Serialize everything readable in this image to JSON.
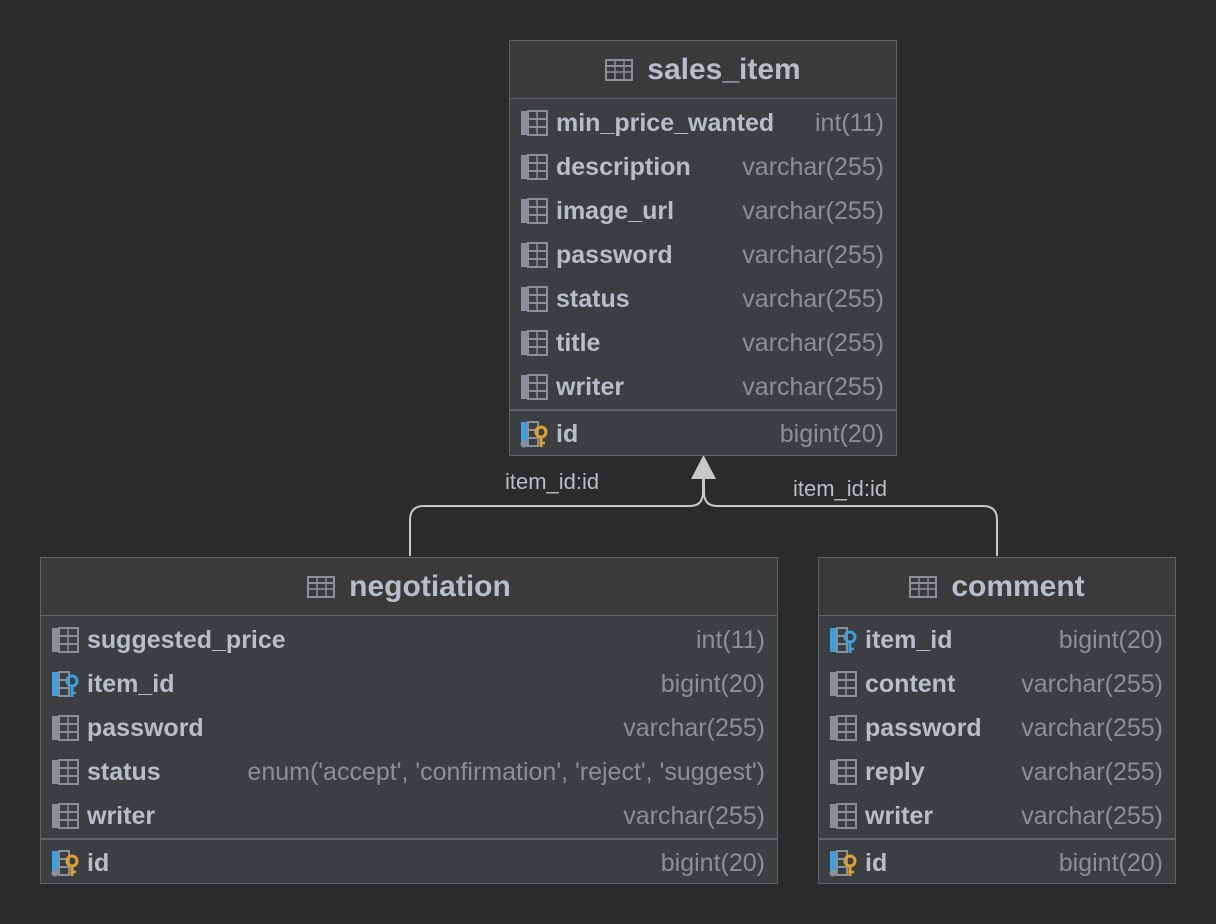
{
  "tables": {
    "sales_item": {
      "name": "sales_item",
      "columns": [
        {
          "name": "min_price_wanted",
          "type": "int(11)",
          "icon": "column-icon"
        },
        {
          "name": "description",
          "type": "varchar(255)",
          "icon": "column-icon"
        },
        {
          "name": "image_url",
          "type": "varchar(255)",
          "icon": "column-icon"
        },
        {
          "name": "password",
          "type": "varchar(255)",
          "icon": "column-icon"
        },
        {
          "name": "status",
          "type": "varchar(255)",
          "icon": "column-icon"
        },
        {
          "name": "title",
          "type": "varchar(255)",
          "icon": "column-icon"
        },
        {
          "name": "writer",
          "type": "varchar(255)",
          "icon": "column-icon"
        }
      ],
      "primary_key": {
        "name": "id",
        "type": "bigint(20)",
        "icon": "primary-key-icon"
      }
    },
    "negotiation": {
      "name": "negotiation",
      "columns": [
        {
          "name": "suggested_price",
          "type": "int(11)",
          "icon": "column-icon"
        },
        {
          "name": "item_id",
          "type": "bigint(20)",
          "icon": "foreign-key-icon"
        },
        {
          "name": "password",
          "type": "varchar(255)",
          "icon": "column-icon"
        },
        {
          "name": "status",
          "type": "enum('accept', 'confirmation', 'reject', 'suggest')",
          "icon": "column-icon"
        },
        {
          "name": "writer",
          "type": "varchar(255)",
          "icon": "column-icon"
        }
      ],
      "primary_key": {
        "name": "id",
        "type": "bigint(20)",
        "icon": "primary-key-icon"
      }
    },
    "comment": {
      "name": "comment",
      "columns": [
        {
          "name": "item_id",
          "type": "bigint(20)",
          "icon": "foreign-key-icon"
        },
        {
          "name": "content",
          "type": "varchar(255)",
          "icon": "column-icon"
        },
        {
          "name": "password",
          "type": "varchar(255)",
          "icon": "column-icon"
        },
        {
          "name": "reply",
          "type": "varchar(255)",
          "icon": "column-icon"
        },
        {
          "name": "writer",
          "type": "varchar(255)",
          "icon": "column-icon"
        }
      ],
      "primary_key": {
        "name": "id",
        "type": "bigint(20)",
        "icon": "primary-key-icon"
      }
    }
  },
  "relations": [
    {
      "from": "negotiation",
      "to": "sales_item",
      "label": "item_id:id"
    },
    {
      "from": "comment",
      "to": "sales_item",
      "label": "item_id:id"
    }
  ],
  "colors": {
    "background": "#2b2b2b",
    "table_body": "#3c3f41",
    "table_border": "#5e6367",
    "text": "#b6bfc9",
    "type_text": "#8a9097",
    "fk_blue": "#3d9ee0",
    "pk_gold": "#e0a030",
    "connector": "#c8c8c8"
  }
}
